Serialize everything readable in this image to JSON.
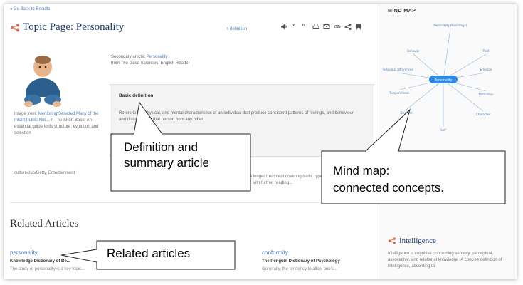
{
  "topic": {
    "back_link": "« Go Back to Results",
    "title": "Topic Page: Personality",
    "definition_link": "+ definition"
  },
  "image_caption": {
    "prefix": "Image from: ",
    "link": "Mentoring Selected Many of the Infant Public Not...",
    "rest": "in The Short Book: An essential guide to its structure, evolution and selection"
  },
  "image_credit": "cultureclub/Getty, Entertainment",
  "source": {
    "line1_prefix": "Secondary article: ",
    "line1_link": "Personality",
    "line2": "from The Good Sciences, English Reader"
  },
  "definition": {
    "heading": "Basic definition",
    "text": "Refers to the physical, and mental characteristics of an individual that produce consistent patterns of feelings, and behaviour and distinguishes that person from any other."
  },
  "more_text": {
    "link": "Overview",
    "text": "A longer treatment covering traits, types, and theories of personality with further reading..."
  },
  "related": {
    "heading": "Related Articles",
    "cards": [
      {
        "title": "personality",
        "source": "Knowledge Dictionary of Be...",
        "desc": "The study of personality is a key topic..."
      },
      {
        "title": "conformity",
        "source": "The Penguin Dictionary of Psychology",
        "desc": "Generally, the tendency to allow one's..."
      }
    ]
  },
  "mindmap": {
    "label": "MIND MAP",
    "center": "Personality",
    "nodes": [
      "Personality (Neurology)",
      "Behavior",
      "Trait",
      "Individual differences",
      "Emotion",
      "Temperament",
      "Motivation",
      "Disorder",
      "Character",
      "Self"
    ]
  },
  "sidebar": {
    "text": "mental disturbances. It may be integral to the discussion and",
    "intel_title": "Intelligence",
    "intel_desc": "Intelligence is cognitive concerning sensory, perceptual, associative, and relational knowledge. A concise definition of intelligence, according to"
  },
  "callouts": {
    "definition_line1": "Definition and",
    "definition_line2": "summary article",
    "mindmap_line1": "Mind map:",
    "mindmap_line2": "connected concepts.",
    "related": "Related articles"
  },
  "colors": {
    "accent": "#1f3f6e",
    "link": "#4a7fb8",
    "share_icon": "#e06a4e",
    "mindmap_center": "#2e8ae6"
  }
}
